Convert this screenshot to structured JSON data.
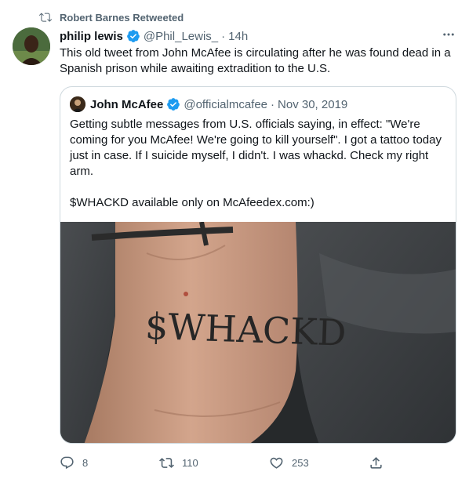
{
  "retweet_banner": {
    "text": "Robert Barnes Retweeted",
    "icon": "retweet-icon"
  },
  "tweet": {
    "author_name": "philip lewis",
    "handle": "@Phil_Lewis_",
    "separator": "·",
    "time": "14h",
    "text": "This old tweet from John McAfee is circulating after he was found dead in a Spanish prison while awaiting extradition to the U.S."
  },
  "quoted_tweet": {
    "author_name": "John McAfee",
    "handle": "@officialmcafee",
    "separator": "·",
    "date": "Nov 30, 2019",
    "text": "Getting subtle messages from U.S. officials saying, in effect: \"We're coming for you McAfee! We're going to kill yourself\". I got a tattoo today just in case. If I suicide myself, I didn't. I was whackd. Check my right arm.\n\n$WHACKD available only on McAfeedex.com:)",
    "image_tattoo_text": "$WHACKD"
  },
  "actions": {
    "replies": "8",
    "retweets": "110",
    "likes": "253"
  },
  "colors": {
    "text_primary": "#0f1419",
    "text_secondary": "#536471",
    "verified_blue": "#1d9bf0",
    "border": "#cfd9de"
  }
}
